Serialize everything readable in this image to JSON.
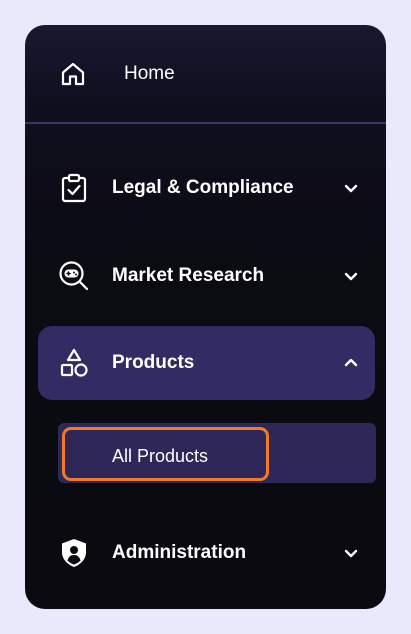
{
  "nav": {
    "home": {
      "label": "Home",
      "icon": "home-icon"
    },
    "items": [
      {
        "label": "Legal & Compliance",
        "icon": "clipboard-check-icon",
        "expanded": false
      },
      {
        "label": "Market Research",
        "icon": "gamepad-search-icon",
        "expanded": false
      },
      {
        "label": "Products",
        "icon": "shapes-icon",
        "expanded": true
      },
      {
        "label": "Administration",
        "icon": "shield-user-icon",
        "expanded": false
      }
    ],
    "products_submenu": [
      {
        "label": "All Products",
        "highlighted": true
      }
    ]
  },
  "colors": {
    "background": "#eae8fb",
    "panel": "#0b0b12",
    "active_item": "#332b63",
    "submenu_bg": "#2e2758",
    "highlight_border": "#f07a2a",
    "divider": "#3a3565",
    "text": "#ffffff"
  }
}
